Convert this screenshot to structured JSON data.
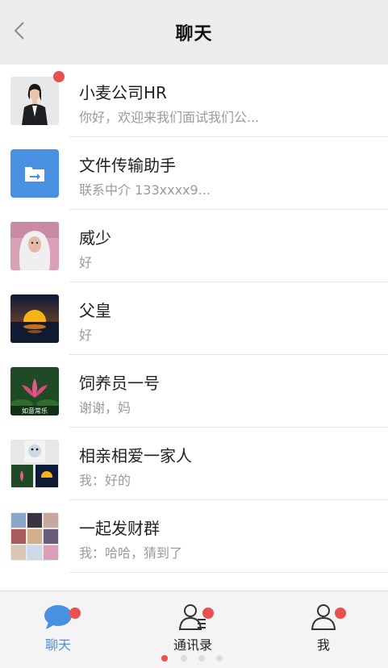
{
  "header": {
    "title": "聊天"
  },
  "chats": [
    {
      "name": "小麦公司HR",
      "preview": "你好，欢迎来我们面试我们公...",
      "avatar": "avatar-businesswoman",
      "unread": true
    },
    {
      "name": "文件传输助手",
      "preview": "联系中介 133xxxx9...",
      "avatar": "folder-arrow-icon",
      "unread": false
    },
    {
      "name": "威少",
      "preview": "好",
      "avatar": "avatar-white-haired-man",
      "unread": false
    },
    {
      "name": "父皇",
      "preview": "好",
      "avatar": "avatar-sunset",
      "unread": false
    },
    {
      "name": "饲养员一号",
      "preview": "谢谢，妈",
      "avatar": "avatar-lotus",
      "lotus_caption": "如意常乐",
      "unread": false
    },
    {
      "name": "相亲相爱一家人",
      "preview": "我：好的",
      "avatar": "avatar-group-composite",
      "unread": false
    },
    {
      "name": "一起发财群",
      "preview": "我：哈哈，猜到了",
      "avatar": "avatar-group-grid",
      "unread": false
    }
  ],
  "tabs": [
    {
      "label": "聊天",
      "icon": "chat-bubble-icon",
      "active": true,
      "badge": true
    },
    {
      "label": "通讯录",
      "icon": "contacts-icon",
      "active": false,
      "badge": true
    },
    {
      "label": "我",
      "icon": "person-icon",
      "active": false,
      "badge": true
    }
  ],
  "colors": {
    "accent": "#4a90e2",
    "badge": "#e9504f",
    "header_bg": "#ececec",
    "tabbar_bg": "#f4f4f4"
  }
}
